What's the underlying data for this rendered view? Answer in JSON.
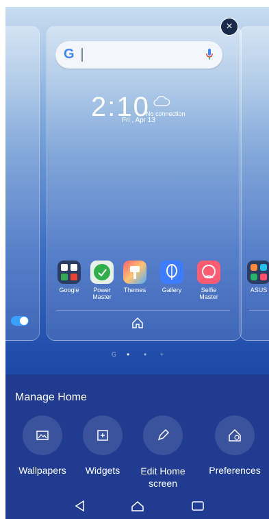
{
  "panels": {
    "center": {
      "search_placeholder": "",
      "clock": "2:10",
      "weather_status": "No connection",
      "date": "Fri , Apr 13",
      "apps": [
        {
          "label": "Google",
          "color": "#2b3c63"
        },
        {
          "label": "Power Master",
          "color": "#e9efe9"
        },
        {
          "label": "Themes",
          "color": "#ff6f6f"
        },
        {
          "label": "Gallery",
          "color": "#3d7cff"
        },
        {
          "label": "Selfie Master",
          "color": "#ff5c74"
        }
      ]
    },
    "right": {
      "app_label": "ASUS"
    }
  },
  "pager": {
    "items": [
      "G",
      "•",
      "•",
      "+"
    ]
  },
  "manage_home": {
    "title": "Manage Home",
    "options": [
      {
        "label": "Wallpapers",
        "icon": "wallpapers-icon"
      },
      {
        "label": "Widgets",
        "icon": "widgets-icon"
      },
      {
        "label": "Edit Home screen",
        "icon": "edit-icon"
      },
      {
        "label": "Preferences",
        "icon": "preferences-icon"
      }
    ]
  },
  "navbar": {
    "items": [
      "back-icon",
      "home-icon",
      "recents-icon"
    ]
  }
}
